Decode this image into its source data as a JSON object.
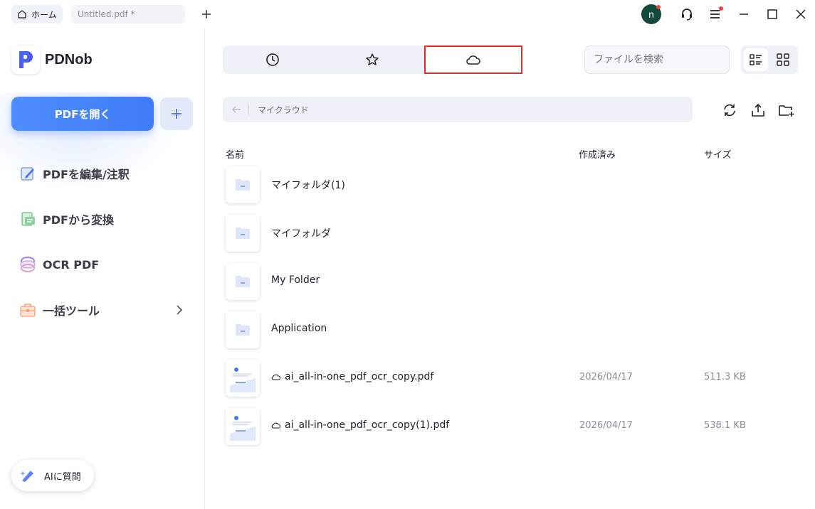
{
  "titlebar": {
    "home_tab": "ホーム",
    "doc_tab": "Untitled.pdf *",
    "avatar_letter": "n",
    "icons": [
      "home-icon",
      "add-tab-icon",
      "support-headset-icon",
      "menu-icon",
      "minimize-icon",
      "maximize-icon",
      "close-icon"
    ]
  },
  "sidebar": {
    "app_name": "PDNob",
    "open_button": "PDFを開く",
    "items": [
      {
        "label": "PDFを編集/注釈",
        "icon": "edit-icon"
      },
      {
        "label": "PDFから変換",
        "icon": "convert-icon"
      },
      {
        "label": "OCR PDF",
        "icon": "ocr-icon"
      },
      {
        "label": "一括ツール",
        "icon": "toolbox-icon"
      }
    ],
    "ai_button": "AIに質問"
  },
  "main": {
    "tabs": [
      "recent-clock-icon",
      "favorites-star-icon",
      "cloud-icon"
    ],
    "active_tab": 2,
    "search_placeholder": "ファイルを検索",
    "breadcrumb": "マイクラウド",
    "columns": {
      "name": "名前",
      "created": "作成済み",
      "size": "サイズ"
    },
    "rows": [
      {
        "name": "マイフォルダ(1)",
        "type": "folder",
        "date": "",
        "size": ""
      },
      {
        "name": "マイフォルダ",
        "type": "folder",
        "date": "",
        "size": ""
      },
      {
        "name": "My Folder",
        "type": "folder",
        "date": "",
        "size": ""
      },
      {
        "name": "Application",
        "type": "folder",
        "date": "",
        "size": ""
      },
      {
        "name": "ai_all-in-one_pdf_ocr_copy.pdf",
        "type": "pdf",
        "date": "2026/04/17",
        "size": "511.3 KB"
      },
      {
        "name": "ai_all-in-one_pdf_ocr_copy(1).pdf",
        "type": "pdf",
        "date": "2026/04/17",
        "size": "538.1 KB"
      }
    ]
  },
  "colors": {
    "accent": "#3f7cf7",
    "highlight_border": "#e02b2b",
    "avatar": "#0f4a3a"
  }
}
